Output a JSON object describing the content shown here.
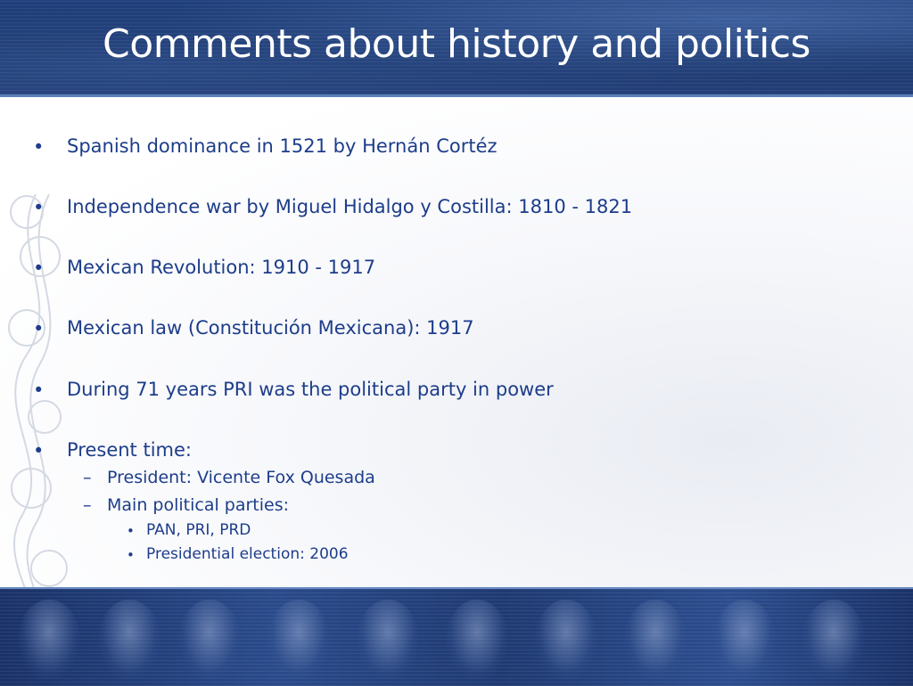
{
  "slide": {
    "title": "Comments about history and politics",
    "bullets": [
      "Spanish dominance in 1521 by Hernán Cortéz",
      "Independence war by Miguel Hidalgo y Costilla: 1810 - 1821",
      "Mexican Revolution: 1910 - 1917",
      "Mexican law (Constitución Mexicana): 1917",
      "During 71 years PRI was the political party in power",
      "Present time:"
    ],
    "sub_bullets": [
      "President: Vicente Fox Quesada",
      "Main political parties:"
    ],
    "sub_sub_bullets": [
      "PAN, PRI, PRD",
      "Presidential election: 2006"
    ],
    "bullet_symbol": "•",
    "dash_symbol": "–"
  },
  "colors": {
    "header_bg": "#1b376d",
    "text": "#1d3d8a",
    "title": "#ffffff"
  }
}
